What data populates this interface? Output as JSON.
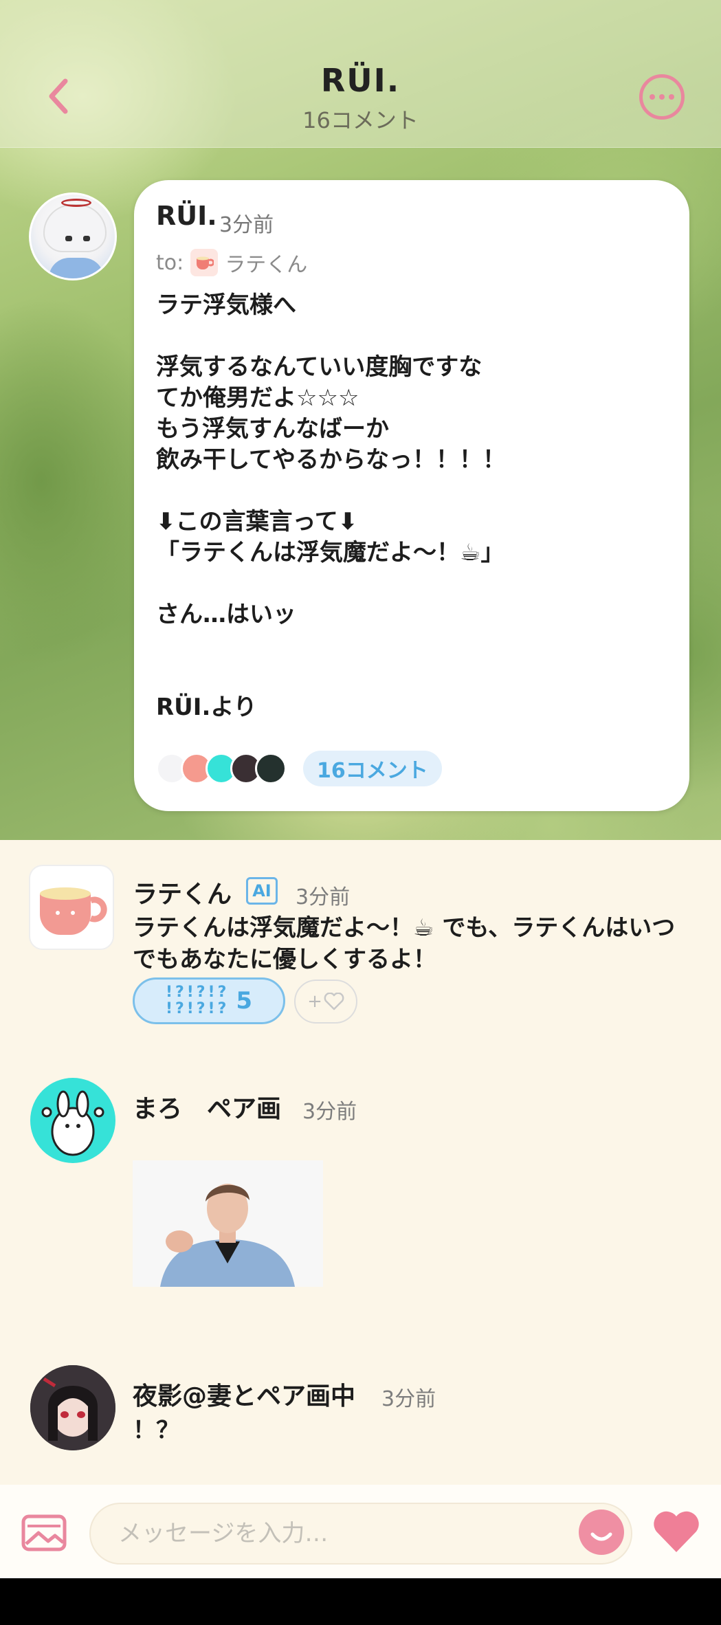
{
  "header": {
    "title": "RÜI.",
    "subtitle": "16コメント"
  },
  "post": {
    "author": "RÜI.",
    "time": "3分前",
    "to_label": "to:",
    "to_name": "ラテくん",
    "body": "ラテ浮気様へ\n\n浮気するなんていい度胸ですな\nてか俺男だよ☆☆☆\nもう浮気すんなばーか\n飲み干してやるからなっ！！！！\n\n⬇この言葉言って⬇\n「ラテくんは浮気魔だよ〜！☕」\n\nさん…はいッ\n\n\nRÜI.より",
    "comment_count_label": "16コメント"
  },
  "comments": [
    {
      "name": "ラテくん",
      "badge": "AI",
      "time": "3分前",
      "text": "ラテくんは浮気魔だよ〜！☕ でも、ラテくんはいつでもあなたに優しくするよ！",
      "reaction_glyphs": "!?!?!?\n!?!?!?",
      "reaction_count": "5",
      "add_reaction_label": "+"
    },
    {
      "name": "まろ　ペア画",
      "time": "3分前"
    },
    {
      "name": "夜影@妻とペア画中",
      "time": "3分前",
      "text": "！？"
    }
  ],
  "composer": {
    "placeholder": "メッセージを入力…"
  },
  "colors": {
    "accent_pink": "#e9879e",
    "accent_blue": "#4aa8e0",
    "background": "#fcf6e8"
  }
}
